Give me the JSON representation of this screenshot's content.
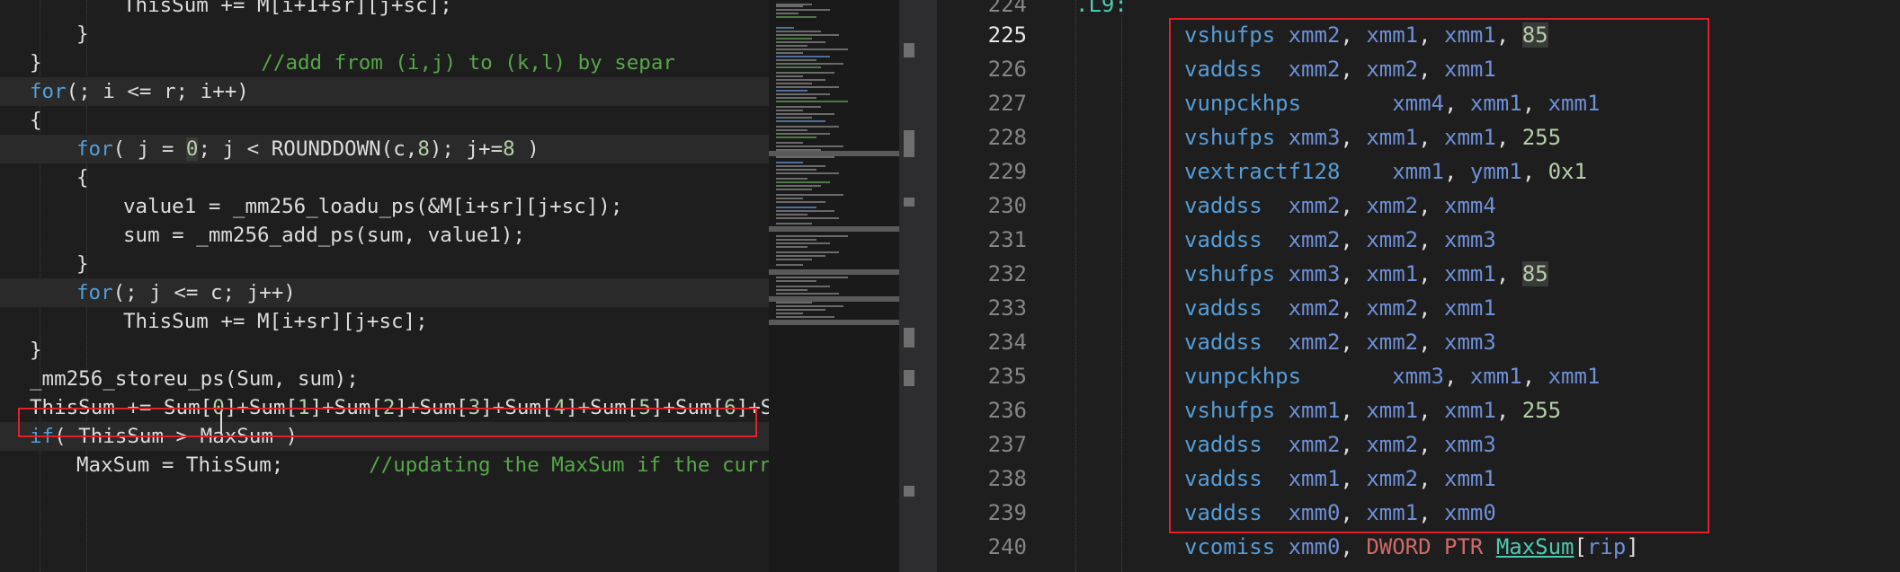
{
  "left_editor": {
    "lines": [
      {
        "indent": 3,
        "parts": [
          {
            "t": "ThisSum += M[i+1+sr][j+sc];",
            "c": ""
          }
        ]
      },
      {
        "indent": 2,
        "parts": [
          {
            "t": "}",
            "c": ""
          }
        ]
      },
      {
        "indent": 1,
        "parts": [
          {
            "t": "}",
            "c": ""
          },
          {
            "t": "                  //add from (i,j) to (k,l) by separ",
            "c": "cm"
          }
        ]
      },
      {
        "indent": 1,
        "alt": true,
        "parts": [
          {
            "t": "for",
            "c": "kw"
          },
          {
            "t": "(; i <= r; i++)",
            "c": ""
          }
        ]
      },
      {
        "indent": 1,
        "parts": [
          {
            "t": "{",
            "c": ""
          }
        ]
      },
      {
        "indent": 2,
        "alt": true,
        "parts": [
          {
            "t": "for",
            "c": "kw"
          },
          {
            "t": "( j = ",
            "c": ""
          },
          {
            "t": "0",
            "c": "num hl"
          },
          {
            "t": "; j < ROUNDDOWN(c,",
            "c": ""
          },
          {
            "t": "8",
            "c": "num"
          },
          {
            "t": "); j+=",
            "c": ""
          },
          {
            "t": "8",
            "c": "num"
          },
          {
            "t": " )",
            "c": ""
          }
        ]
      },
      {
        "indent": 2,
        "parts": [
          {
            "t": "{",
            "c": ""
          }
        ]
      },
      {
        "indent": 3,
        "parts": [
          {
            "t": "value1 = _mm256_loadu_ps(&M[i+sr][j+sc]);",
            "c": ""
          }
        ]
      },
      {
        "indent": 3,
        "parts": [
          {
            "t": "sum = _mm256_add_ps(sum, value1);",
            "c": ""
          }
        ]
      },
      {
        "indent": 2,
        "parts": [
          {
            "t": "}",
            "c": ""
          }
        ]
      },
      {
        "indent": 2,
        "alt": true,
        "parts": [
          {
            "t": "for",
            "c": "kw"
          },
          {
            "t": "(; j <= c; j++)",
            "c": ""
          }
        ]
      },
      {
        "indent": 3,
        "parts": [
          {
            "t": "ThisSum += M[i+sr][j+sc];",
            "c": ""
          }
        ]
      },
      {
        "indent": 1,
        "parts": [
          {
            "t": "}",
            "c": ""
          }
        ]
      },
      {
        "indent": 1,
        "parts": [
          {
            "t": "_mm256_storeu_ps(Sum, sum);",
            "c": ""
          }
        ]
      },
      {
        "indent": 1,
        "parts": [
          {
            "t": "ThisSum += Sum[",
            "c": ""
          },
          {
            "t": "0",
            "c": "num"
          },
          {
            "t": "]+Sum[",
            "c": ""
          },
          {
            "t": "1",
            "c": "num"
          },
          {
            "t": "]+Sum[",
            "c": ""
          },
          {
            "t": "2",
            "c": "num"
          },
          {
            "t": "]+Sum[",
            "c": ""
          },
          {
            "t": "3",
            "c": "num"
          },
          {
            "t": "]+Sum[",
            "c": ""
          },
          {
            "t": "4",
            "c": "num"
          },
          {
            "t": "]+Sum[",
            "c": ""
          },
          {
            "t": "5",
            "c": "num"
          },
          {
            "t": "]+Sum[",
            "c": ""
          },
          {
            "t": "6",
            "c": "num"
          },
          {
            "t": "]+Su",
            "c": ""
          }
        ]
      },
      {
        "indent": 1,
        "alt": true,
        "parts": [
          {
            "t": "if",
            "c": "kw"
          },
          {
            "t": "( ThisSum > MaxSum )",
            "c": ""
          }
        ]
      },
      {
        "indent": 2,
        "parts": [
          {
            "t": "MaxSum = ThisSum;",
            "c": ""
          },
          {
            "t": "       //updating the MaxSum if the curren",
            "c": "cm"
          }
        ]
      }
    ]
  },
  "right_editor": {
    "label_line": {
      "number": "224",
      "text": ".L9:"
    },
    "lines": [
      {
        "n": "225",
        "cur": true,
        "parts": [
          {
            "t": "vshufps",
            "c": "instr"
          },
          {
            "t": " xmm2",
            "c": "reg"
          },
          {
            "t": ", ",
            "c": "punc"
          },
          {
            "t": "xmm1",
            "c": "reg"
          },
          {
            "t": ", ",
            "c": "punc"
          },
          {
            "t": "xmm1",
            "c": "reg"
          },
          {
            "t": ", ",
            "c": "punc"
          },
          {
            "t": "85",
            "c": "immhl"
          }
        ]
      },
      {
        "n": "226",
        "parts": [
          {
            "t": "vaddss",
            "c": "instr"
          },
          {
            "t": "  xmm2",
            "c": "reg"
          },
          {
            "t": ", ",
            "c": "punc"
          },
          {
            "t": "xmm2",
            "c": "reg"
          },
          {
            "t": ", ",
            "c": "punc"
          },
          {
            "t": "xmm1",
            "c": "reg"
          }
        ]
      },
      {
        "n": "227",
        "parts": [
          {
            "t": "vunpckhps",
            "c": "instr"
          },
          {
            "t": "       xmm4",
            "c": "reg"
          },
          {
            "t": ", ",
            "c": "punc"
          },
          {
            "t": "xmm1",
            "c": "reg"
          },
          {
            "t": ", ",
            "c": "punc"
          },
          {
            "t": "xmm1",
            "c": "reg"
          }
        ]
      },
      {
        "n": "228",
        "parts": [
          {
            "t": "vshufps",
            "c": "instr"
          },
          {
            "t": " xmm3",
            "c": "reg"
          },
          {
            "t": ", ",
            "c": "punc"
          },
          {
            "t": "xmm1",
            "c": "reg"
          },
          {
            "t": ", ",
            "c": "punc"
          },
          {
            "t": "xmm1",
            "c": "reg"
          },
          {
            "t": ", ",
            "c": "punc"
          },
          {
            "t": "255",
            "c": "imm"
          }
        ]
      },
      {
        "n": "229",
        "parts": [
          {
            "t": "vextractf128",
            "c": "instr"
          },
          {
            "t": "    xmm1",
            "c": "reg"
          },
          {
            "t": ", ",
            "c": "punc"
          },
          {
            "t": "ymm1",
            "c": "reg"
          },
          {
            "t": ", ",
            "c": "punc"
          },
          {
            "t": "0x1",
            "c": "imm"
          }
        ]
      },
      {
        "n": "230",
        "parts": [
          {
            "t": "vaddss",
            "c": "instr"
          },
          {
            "t": "  xmm2",
            "c": "reg"
          },
          {
            "t": ", ",
            "c": "punc"
          },
          {
            "t": "xmm2",
            "c": "reg"
          },
          {
            "t": ", ",
            "c": "punc"
          },
          {
            "t": "xmm4",
            "c": "reg"
          }
        ]
      },
      {
        "n": "231",
        "parts": [
          {
            "t": "vaddss",
            "c": "instr"
          },
          {
            "t": "  xmm2",
            "c": "reg"
          },
          {
            "t": ", ",
            "c": "punc"
          },
          {
            "t": "xmm2",
            "c": "reg"
          },
          {
            "t": ", ",
            "c": "punc"
          },
          {
            "t": "xmm3",
            "c": "reg"
          }
        ]
      },
      {
        "n": "232",
        "parts": [
          {
            "t": "vshufps",
            "c": "instr"
          },
          {
            "t": " xmm3",
            "c": "reg"
          },
          {
            "t": ", ",
            "c": "punc"
          },
          {
            "t": "xmm1",
            "c": "reg"
          },
          {
            "t": ", ",
            "c": "punc"
          },
          {
            "t": "xmm1",
            "c": "reg"
          },
          {
            "t": ", ",
            "c": "punc"
          },
          {
            "t": "85",
            "c": "immhl"
          }
        ]
      },
      {
        "n": "233",
        "parts": [
          {
            "t": "vaddss",
            "c": "instr"
          },
          {
            "t": "  xmm2",
            "c": "reg"
          },
          {
            "t": ", ",
            "c": "punc"
          },
          {
            "t": "xmm2",
            "c": "reg"
          },
          {
            "t": ", ",
            "c": "punc"
          },
          {
            "t": "xmm1",
            "c": "reg"
          }
        ]
      },
      {
        "n": "234",
        "parts": [
          {
            "t": "vaddss",
            "c": "instr"
          },
          {
            "t": "  xmm2",
            "c": "reg"
          },
          {
            "t": ", ",
            "c": "punc"
          },
          {
            "t": "xmm2",
            "c": "reg"
          },
          {
            "t": ", ",
            "c": "punc"
          },
          {
            "t": "xmm3",
            "c": "reg"
          }
        ]
      },
      {
        "n": "235",
        "parts": [
          {
            "t": "vunpckhps",
            "c": "instr"
          },
          {
            "t": "       xmm3",
            "c": "reg"
          },
          {
            "t": ", ",
            "c": "punc"
          },
          {
            "t": "xmm1",
            "c": "reg"
          },
          {
            "t": ", ",
            "c": "punc"
          },
          {
            "t": "xmm1",
            "c": "reg"
          }
        ]
      },
      {
        "n": "236",
        "parts": [
          {
            "t": "vshufps",
            "c": "instr"
          },
          {
            "t": " xmm1",
            "c": "reg"
          },
          {
            "t": ", ",
            "c": "punc"
          },
          {
            "t": "xmm1",
            "c": "reg"
          },
          {
            "t": ", ",
            "c": "punc"
          },
          {
            "t": "xmm1",
            "c": "reg"
          },
          {
            "t": ", ",
            "c": "punc"
          },
          {
            "t": "255",
            "c": "imm"
          }
        ]
      },
      {
        "n": "237",
        "parts": [
          {
            "t": "vaddss",
            "c": "instr"
          },
          {
            "t": "  xmm2",
            "c": "reg"
          },
          {
            "t": ", ",
            "c": "punc"
          },
          {
            "t": "xmm2",
            "c": "reg"
          },
          {
            "t": ", ",
            "c": "punc"
          },
          {
            "t": "xmm3",
            "c": "reg"
          }
        ]
      },
      {
        "n": "238",
        "parts": [
          {
            "t": "vaddss",
            "c": "instr"
          },
          {
            "t": "  xmm1",
            "c": "reg"
          },
          {
            "t": ", ",
            "c": "punc"
          },
          {
            "t": "xmm2",
            "c": "reg"
          },
          {
            "t": ", ",
            "c": "punc"
          },
          {
            "t": "xmm1",
            "c": "reg"
          }
        ]
      },
      {
        "n": "239",
        "parts": [
          {
            "t": "vaddss",
            "c": "instr"
          },
          {
            "t": "  xmm0",
            "c": "reg"
          },
          {
            "t": ", ",
            "c": "punc"
          },
          {
            "t": "xmm1",
            "c": "reg"
          },
          {
            "t": ", ",
            "c": "punc"
          },
          {
            "t": "xmm0",
            "c": "reg"
          }
        ]
      },
      {
        "n": "240",
        "parts": [
          {
            "t": "vcomiss",
            "c": "instr"
          },
          {
            "t": " xmm0",
            "c": "reg"
          },
          {
            "t": ", ",
            "c": "punc"
          },
          {
            "t": "DWORD PTR ",
            "c": "dw"
          },
          {
            "t": "MaxSum",
            "c": "sym"
          },
          {
            "t": "[",
            "c": "punc"
          },
          {
            "t": "rip",
            "c": "reg"
          },
          {
            "t": "]",
            "c": "punc"
          }
        ]
      }
    ]
  }
}
